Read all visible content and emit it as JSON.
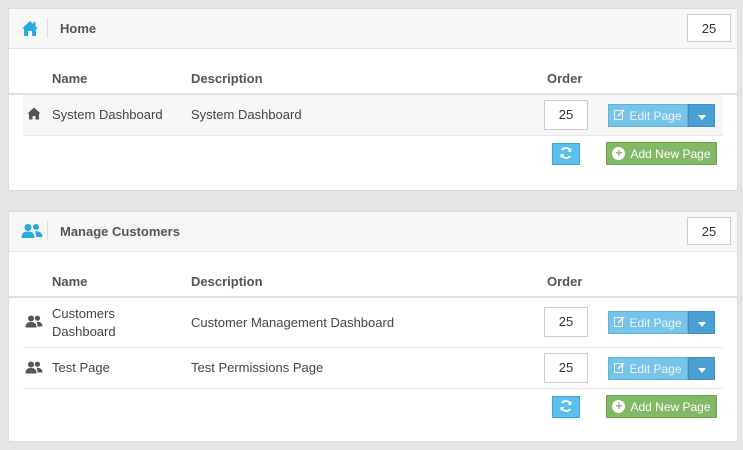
{
  "colors": {
    "accent": "#27a9e1",
    "edit_button": "#78c3e8",
    "edit_caret": "#4a9fd3",
    "refresh_button": "#5bc0ec",
    "add_button": "#82b964"
  },
  "columns": {
    "name": "Name",
    "description": "Description",
    "order": "Order"
  },
  "buttons": {
    "edit": "Edit Page",
    "add": "Add New Page"
  },
  "sections": [
    {
      "title": "Home",
      "icon": "home-icon",
      "order": "25",
      "rows": [
        {
          "name": "System Dashboard",
          "description": "System Dashboard",
          "order": "25",
          "icon": "home-icon"
        }
      ]
    },
    {
      "title": "Manage Customers",
      "icon": "users-icon",
      "order": "25",
      "rows": [
        {
          "name_line1": "Customers",
          "name_line2": "Dashboard",
          "description": "Customer Management Dashboard",
          "order": "25",
          "icon": "users-icon"
        },
        {
          "name": "Test Page",
          "description": "Test Permissions Page",
          "order": "25",
          "icon": "users-icon"
        }
      ]
    }
  ]
}
